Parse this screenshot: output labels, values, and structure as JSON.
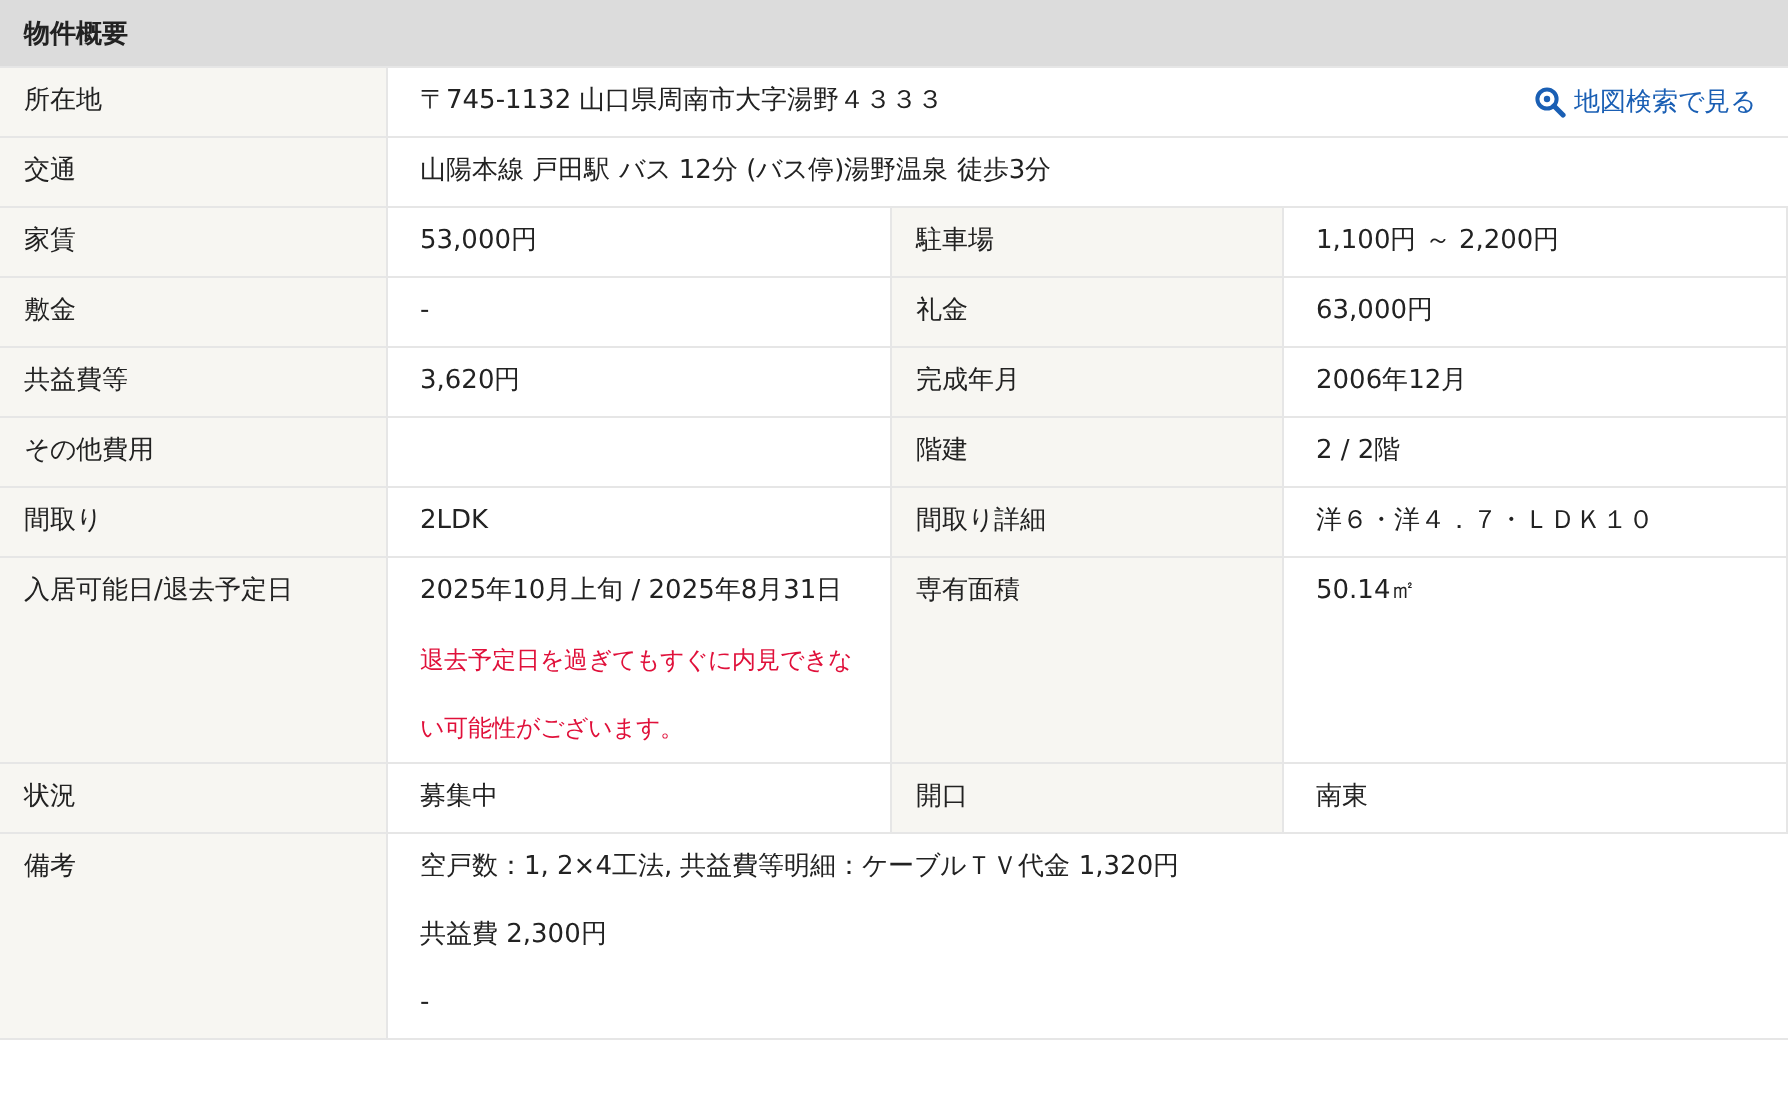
{
  "section_title": "物件概要",
  "rows": [
    {
      "kind": "wide",
      "label": "所在地",
      "lines": [
        "〒745-1132 山口県周南市大字湯野４３３３"
      ],
      "link": "地図検索で見る"
    },
    {
      "kind": "wide",
      "label": "交通",
      "lines": [
        "山陽本線 戸田駅 バス 12分 (バス停)湯野温泉 徒歩3分"
      ]
    },
    {
      "kind": "pair",
      "items": [
        {
          "label": "家賃",
          "value": "53,000円"
        },
        {
          "label": "駐車場",
          "value": "1,100円 ～ 2,200円"
        }
      ]
    },
    {
      "kind": "pair",
      "items": [
        {
          "label": "敷金",
          "value": "-"
        },
        {
          "label": "礼金",
          "value": "63,000円"
        }
      ]
    },
    {
      "kind": "pair",
      "items": [
        {
          "label": "共益費等",
          "value": "3,620円"
        },
        {
          "label": "完成年月",
          "value": "2006年12月"
        }
      ]
    },
    {
      "kind": "pair",
      "items": [
        {
          "label": "その他費用"
        },
        {
          "label": "階建",
          "value": "2 / 2階"
        }
      ]
    },
    {
      "kind": "pair",
      "items": [
        {
          "label": "間取り",
          "value": "2LDK"
        },
        {
          "label": "間取り詳細",
          "value": "洋６・洋４．７・ＬＤＫ１０"
        }
      ]
    },
    {
      "kind": "pair",
      "items": [
        {
          "label": "入居可能日/退去予定日",
          "value": "2025年10月上旬 / 2025年8月31日",
          "note": "退去予定日を過ぎてもすぐに内見できない可能性がございます。"
        },
        {
          "label": "専有面積",
          "value": "50.14㎡"
        }
      ]
    },
    {
      "kind": "pair",
      "items": [
        {
          "label": "状況",
          "value": "募集中"
        },
        {
          "label": "開口",
          "value": "南東"
        }
      ]
    },
    {
      "kind": "wide",
      "label": "備考",
      "lines": [
        "空戸数：1, 2×4工法, 共益費等明細：ケーブルＴＶ代金 1,320円",
        "共益費 2,300円",
        "-"
      ]
    }
  ]
}
